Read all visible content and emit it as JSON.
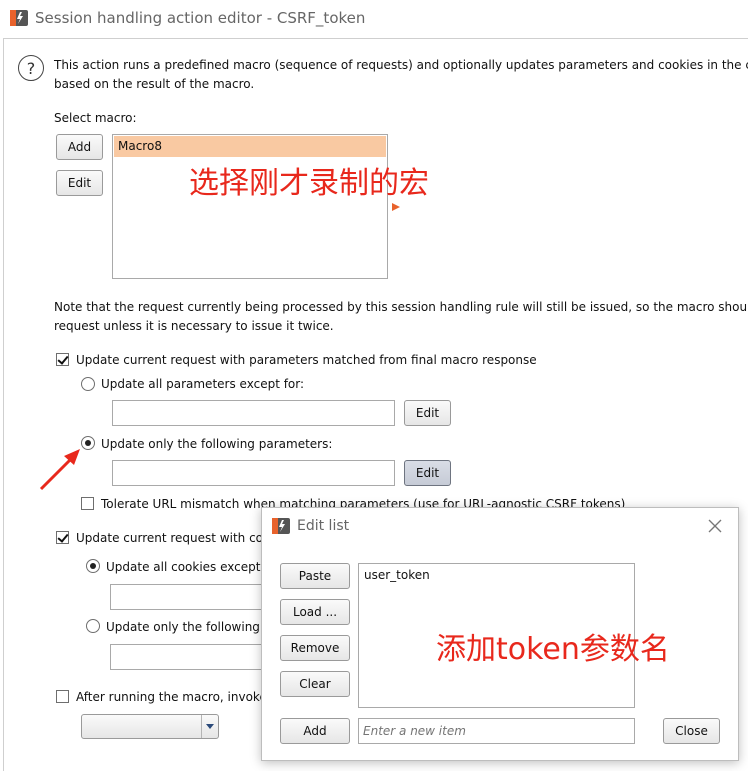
{
  "window": {
    "title": "Session handling action editor - CSRF_token"
  },
  "intro": {
    "line1": "This action runs a predefined macro (sequence of requests) and optionally updates parameters and cookies in the curren",
    "line2": "based on the result of the macro."
  },
  "macro": {
    "select_label": "Select macro:",
    "add_label": "Add",
    "edit_label": "Edit",
    "items": [
      "Macro8"
    ],
    "selected": "Macro8"
  },
  "note": {
    "line1": "Note that the request currently being processed by this session handling rule will still be issued, so the macro should no",
    "line2": "request unless it is necessary to issue it twice."
  },
  "params": {
    "update_label": "Update current request with parameters matched from final macro response",
    "update_checked": true,
    "all_except_label": "Update all parameters except for:",
    "all_except_value": "",
    "only_following_label": "Update only the following parameters:",
    "only_following_value": "",
    "edit_label": "Edit",
    "selected_option": "only_following",
    "tolerate_label": "Tolerate URL mismatch when matching parameters (use for URL-agnostic CSRF tokens)",
    "tolerate_checked": false
  },
  "cookies": {
    "update_label": "Update current request with coo",
    "update_checked": true,
    "all_except_label": "Update all cookies except f",
    "only_following_label": "Update only the following c",
    "selected_option": "all_except"
  },
  "after": {
    "label": "After running the macro, invoke a",
    "checked": false,
    "dropdown_value": ""
  },
  "annotations": {
    "select_macro": "选择刚才录制的宏",
    "add_token": "添加token参数名",
    "arrow_color": "#e8281c"
  },
  "edit_list": {
    "title": "Edit list",
    "paste_label": "Paste",
    "load_label": "Load ...",
    "remove_label": "Remove",
    "clear_label": "Clear",
    "add_label": "Add",
    "close_label": "Close",
    "items": [
      "user_token"
    ],
    "new_item_placeholder": "Enter a new item"
  },
  "colors": {
    "selection": "#f9c9a2",
    "burp_orange": "#e8622c",
    "annotation": "#e8281c"
  }
}
